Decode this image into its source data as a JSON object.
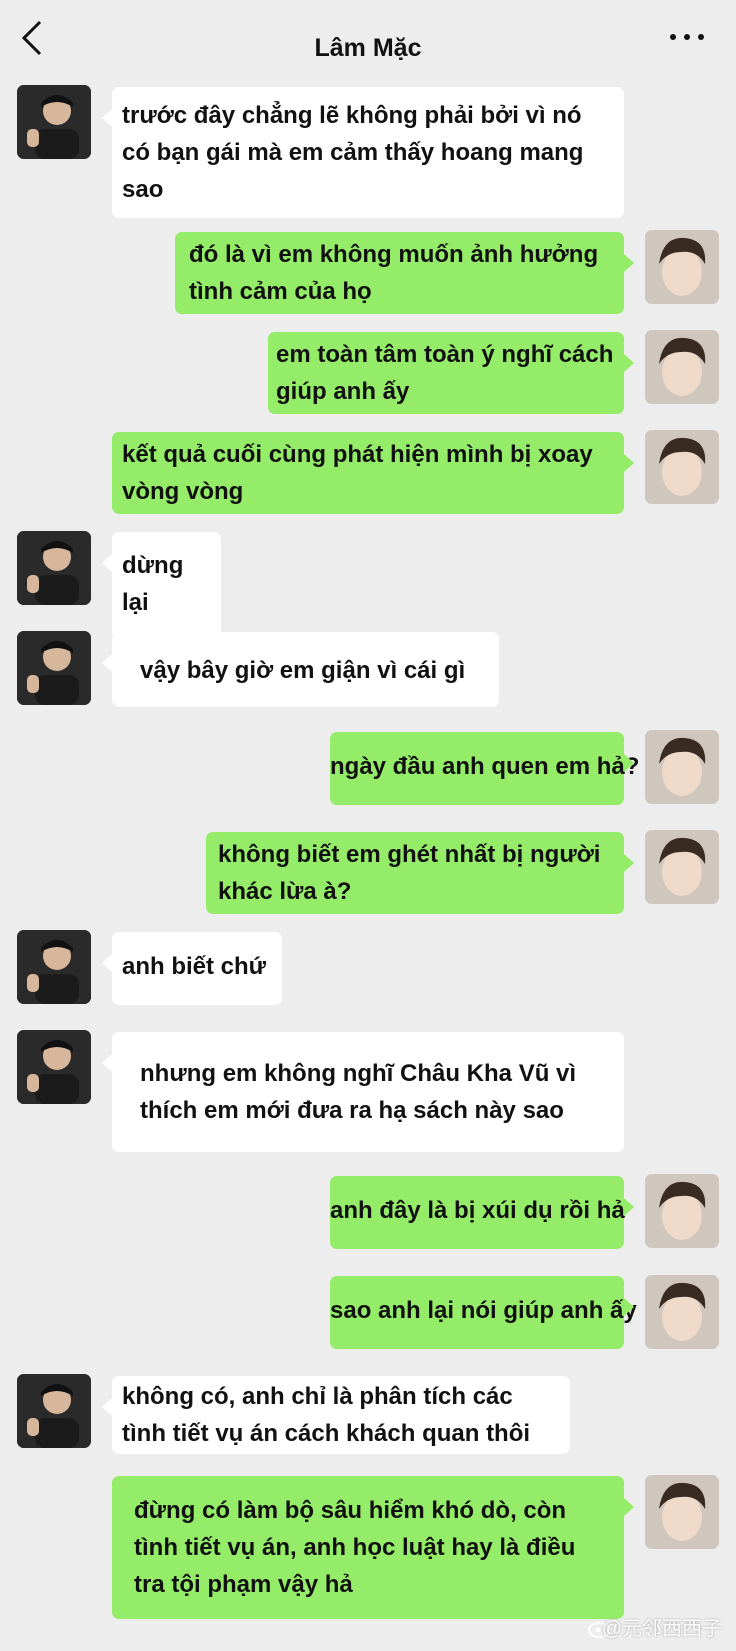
{
  "header": {
    "title": "Lâm Mặc",
    "back_icon": "chevron-left-icon",
    "more_icon": "more-dots-icon"
  },
  "colors": {
    "background": "#ededed",
    "incoming_bubble": "#ffffff",
    "outgoing_bubble": "#95ec69"
  },
  "messages": [
    {
      "side": "in",
      "text": "trước đây chẳng lẽ không phải bởi vì nó có bạn gái mà em cảm  thấy hoang mang sao"
    },
    {
      "side": "out",
      "text": "đó là vì em không muốn ảnh hưởng tình cảm của họ"
    },
    {
      "side": "out",
      "text": "em toàn tâm toàn ý nghĩ cách giúp anh ấy"
    },
    {
      "side": "out",
      "text": "kết quả cuối cùng phát hiện mình bị xoay vòng vòng"
    },
    {
      "side": "in",
      "text": "dừng lại"
    },
    {
      "side": "in",
      "text": "vậy bây giờ em giận vì cái gì"
    },
    {
      "side": "out",
      "text": "ngày đầu anh quen em hả?"
    },
    {
      "side": "out",
      "text": "không biết em ghét nhất bị người khác lừa à?"
    },
    {
      "side": "in",
      "text": "anh biết chứ"
    },
    {
      "side": "in",
      "text": "nhưng em không nghĩ Châu Kha Vũ vì thích em mới đưa ra hạ sách này sao"
    },
    {
      "side": "out",
      "text": "anh đây là bị xúi dụ rồi hả"
    },
    {
      "side": "out",
      "text": "sao anh lại nói giúp anh ấy"
    },
    {
      "side": "in",
      "text": "không có, anh chỉ là phân tích các tình tiết vụ án cách khách quan thôi"
    },
    {
      "side": "out",
      "text": "đừng có làm bộ sâu hiểm khó dò, còn tình tiết vụ án, anh học luật hay là điều tra tội phạm vậy hả"
    }
  ],
  "footer": {
    "watermark": "@元邻西西子"
  }
}
